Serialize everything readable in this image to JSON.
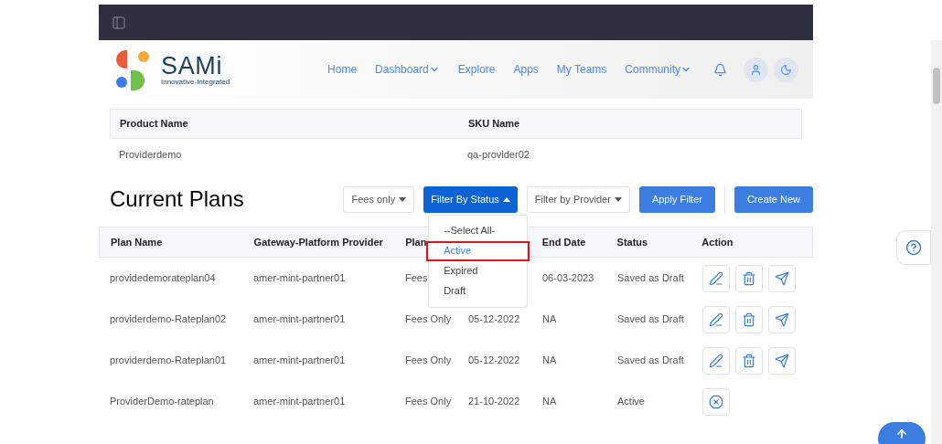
{
  "brand": {
    "name": "SAMi",
    "tagline": "Innovative-Integrated"
  },
  "nav": [
    {
      "label": "Home",
      "dropdown": false
    },
    {
      "label": "Dashboard",
      "dropdown": true
    },
    {
      "label": "Explore",
      "dropdown": false
    },
    {
      "label": "Apps",
      "dropdown": false
    },
    {
      "label": "My Teams",
      "dropdown": false
    },
    {
      "label": "Community",
      "dropdown": true
    }
  ],
  "product_table": {
    "columns": [
      "Product Name",
      "SKU Name"
    ],
    "rows": [
      [
        "Providerdemo",
        "qa-provider02"
      ]
    ]
  },
  "plans": {
    "title": "Current Plans",
    "filters": [
      {
        "label": "Fees only",
        "open": false,
        "primary": false
      },
      {
        "label": "Filter By Status",
        "open": true,
        "primary": true
      },
      {
        "label": "Filter by Provider",
        "open": false,
        "primary": false
      }
    ],
    "apply_button": "Apply Filter",
    "create_button": "Create New",
    "status_menu": [
      {
        "label": "--Select All-",
        "selected": false
      },
      {
        "label": "Active",
        "selected": true
      },
      {
        "label": "Expired",
        "selected": false
      },
      {
        "label": "Draft",
        "selected": false
      }
    ],
    "columns": [
      "Plan Name",
      "Gateway-Platform Provider",
      "Plan",
      null,
      "End Date",
      "Status",
      "Action"
    ],
    "rows": [
      {
        "cells": [
          "providedemorateplan04",
          "amer-mint-partner01",
          "Fees",
          null,
          "06-03-2023",
          "Saved as Draft"
        ],
        "actions": [
          {
            "kind": "edit"
          },
          {
            "kind": "delete"
          },
          {
            "kind": "send"
          }
        ]
      },
      {
        "cells": [
          "providerdemo-Rateplan02",
          "amer-mint-partner01",
          "Fees Only",
          "05-12-2022",
          "NA",
          "Saved as Draft"
        ],
        "actions": [
          {
            "kind": "edit"
          },
          {
            "kind": "delete"
          },
          {
            "kind": "send"
          }
        ]
      },
      {
        "cells": [
          "providerdemo-Rateplan01",
          "amer-mint-partner01",
          "Fees Only",
          "05-12-2022",
          "NA",
          "Saved as Draft"
        ],
        "actions": [
          {
            "kind": "edit"
          },
          {
            "kind": "delete"
          },
          {
            "kind": "send"
          }
        ]
      },
      {
        "cells": [
          "ProviderDemo-rateplan",
          "amer-mint-partner01",
          "Fees Only",
          "21-10-2022",
          "NA",
          "Active"
        ],
        "actions": [
          {
            "kind": "cancel"
          }
        ]
      }
    ]
  }
}
